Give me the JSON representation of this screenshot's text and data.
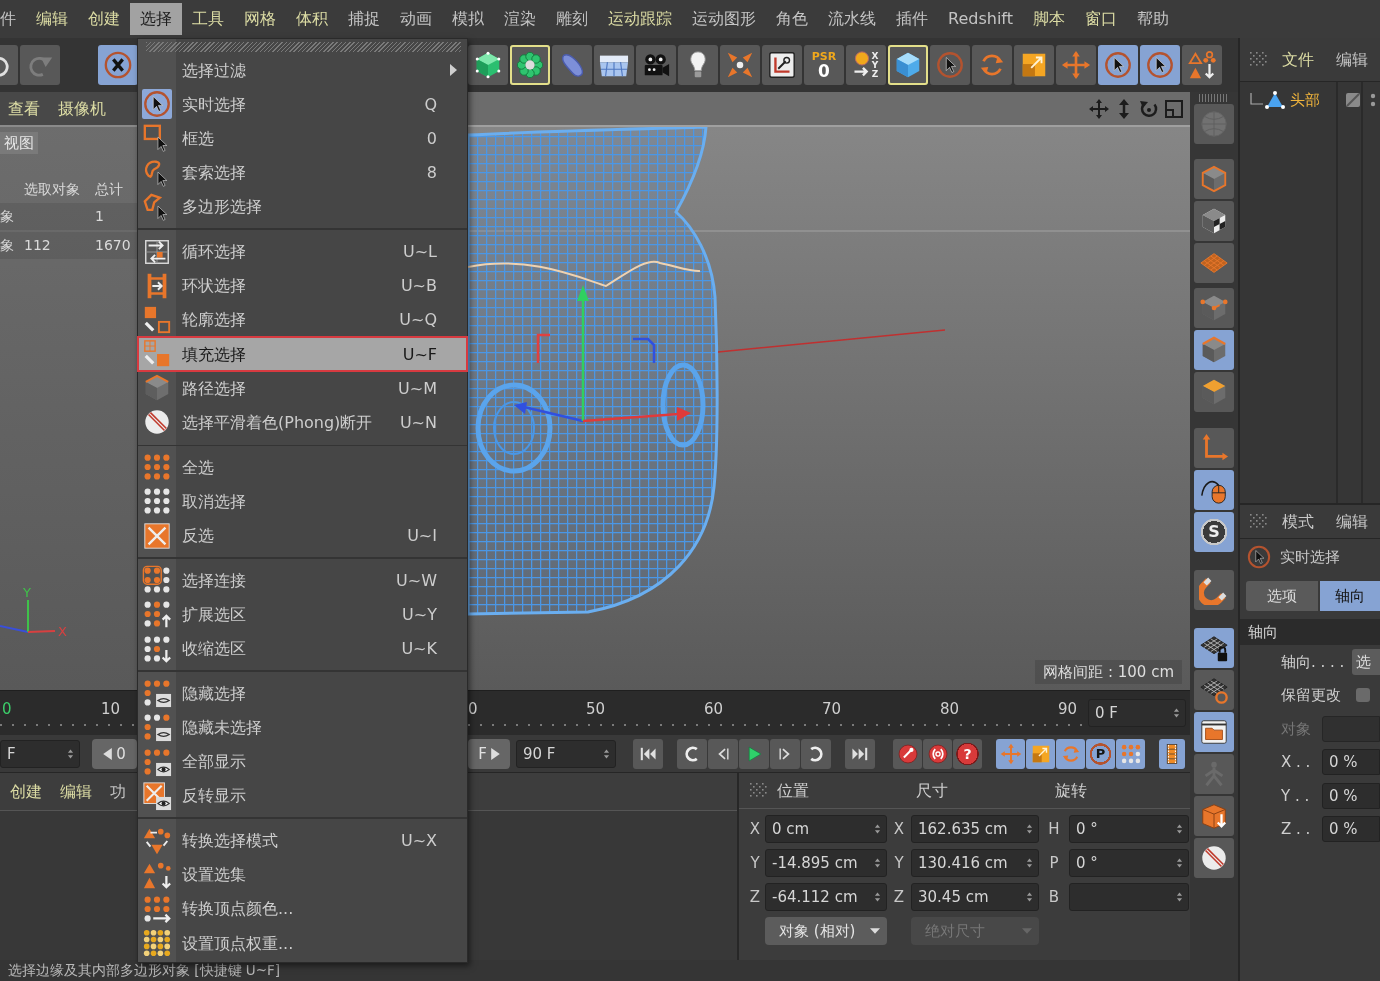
{
  "menu_bar": [
    {
      "label": "件",
      "color": "#c4c4c4",
      "selected": false
    },
    {
      "label": "编辑",
      "color": "#dcdca4",
      "selected": false
    },
    {
      "label": "创建",
      "color": "#dcdca4",
      "selected": false
    },
    {
      "label": "选择",
      "selected": true
    },
    {
      "label": "工具",
      "color": "#dcdca4",
      "selected": false
    },
    {
      "label": "网格",
      "color": "#dcdca4",
      "selected": false
    },
    {
      "label": "体积",
      "color": "#dcdca4",
      "selected": false
    },
    {
      "label": "捕捉",
      "color": "#c4c4c4",
      "selected": false
    },
    {
      "label": "动画",
      "color": "#c4c4c4",
      "selected": false
    },
    {
      "label": "模拟",
      "color": "#c4c4c4",
      "selected": false
    },
    {
      "label": "渲染",
      "color": "#c4c4c4",
      "selected": false
    },
    {
      "label": "雕刻",
      "color": "#c4c4c4",
      "selected": false
    },
    {
      "label": "运动跟踪",
      "color": "#dcdca4",
      "selected": false
    },
    {
      "label": "运动图形",
      "color": "#c4c4c4",
      "selected": false
    },
    {
      "label": "角色",
      "color": "#c4c4c4",
      "selected": false
    },
    {
      "label": "流水线",
      "color": "#c4c4c4",
      "selected": false
    },
    {
      "label": "插件",
      "color": "#c4c4c4",
      "selected": false
    },
    {
      "label": "Redshift",
      "color": "#c4c4c4",
      "selected": false
    },
    {
      "label": "脚本",
      "color": "#dcdca4",
      "selected": false
    },
    {
      "label": "窗口",
      "color": "#dcdca4",
      "selected": false
    },
    {
      "label": "帮助",
      "color": "#c4c4c4",
      "selected": false
    }
  ],
  "main_toolbar": [
    {
      "on": false,
      "framed": false,
      "disabled": false
    },
    {
      "on": false,
      "framed": false,
      "disabled": true
    },
    {
      "on": true,
      "framed": false,
      "disabled": false
    },
    {
      "on": false,
      "framed": false,
      "disabled": false
    },
    {
      "on": false,
      "framed": true,
      "disabled": false
    },
    {
      "on": false,
      "framed": false,
      "disabled": false
    },
    {
      "on": false,
      "framed": false,
      "disabled": false
    },
    {
      "on": false,
      "framed": false,
      "disabled": false
    },
    {
      "on": false,
      "framed": false,
      "disabled": false
    },
    {
      "on": false,
      "framed": false,
      "disabled": false
    },
    {
      "on": false,
      "framed": false,
      "disabled": false
    },
    {
      "on": false,
      "framed": false,
      "disabled": false,
      "text": "PSR",
      "value": "0"
    },
    {
      "on": false,
      "framed": false,
      "disabled": false,
      "text": "XYZ"
    },
    {
      "on": false,
      "framed": true,
      "disabled": false
    },
    {
      "on": false,
      "framed": false,
      "disabled": false
    },
    {
      "on": false,
      "framed": false,
      "disabled": false
    },
    {
      "on": false,
      "framed": false,
      "disabled": false
    },
    {
      "on": false,
      "framed": false,
      "disabled": false
    },
    {
      "on": true,
      "framed": false,
      "disabled": false
    },
    {
      "on": true,
      "framed": false,
      "disabled": false
    },
    {
      "on": false,
      "framed": false,
      "disabled": false
    }
  ],
  "select_menu": {
    "sections": [
      {
        "items": [
          {
            "label": "选择过滤",
            "submenu": true,
            "active": false,
            "selected": false,
            "annotated": false
          },
          {
            "label": "实时选择",
            "shortcut": "Q",
            "submenu": false,
            "active": true,
            "selected": false,
            "annotated": false
          },
          {
            "label": "框选",
            "shortcut": "0",
            "submenu": false,
            "active": false,
            "selected": false,
            "annotated": false
          },
          {
            "label": "套索选择",
            "shortcut": "8",
            "submenu": false,
            "active": false,
            "selected": false,
            "annotated": false
          },
          {
            "label": "多边形选择",
            "submenu": false,
            "active": false,
            "selected": false,
            "annotated": false
          }
        ]
      },
      {
        "items": [
          {
            "label": "循环选择",
            "shortcut": "U~L",
            "submenu": false,
            "active": false,
            "selected": false,
            "annotated": false
          },
          {
            "label": "环状选择",
            "shortcut": "U~B",
            "submenu": false,
            "active": false,
            "selected": false,
            "annotated": false
          },
          {
            "label": "轮廓选择",
            "shortcut": "U~Q",
            "submenu": false,
            "active": false,
            "selected": false,
            "annotated": false
          },
          {
            "label": "填充选择",
            "shortcut": "U~F",
            "submenu": false,
            "active": false,
            "selected": true,
            "annotated": true
          },
          {
            "label": "路径选择",
            "shortcut": "U~M",
            "submenu": false,
            "active": false,
            "selected": false,
            "annotated": false
          },
          {
            "label": "选择平滑着色(Phong)断开",
            "shortcut": "U~N",
            "submenu": false,
            "active": false,
            "selected": false,
            "annotated": false
          }
        ]
      },
      {
        "items": [
          {
            "label": "全选",
            "submenu": false,
            "active": false,
            "selected": false,
            "annotated": false
          },
          {
            "label": "取消选择",
            "submenu": false,
            "active": false,
            "selected": false,
            "annotated": false
          },
          {
            "label": "反选",
            "shortcut": "U~I",
            "submenu": false,
            "active": false,
            "selected": false,
            "annotated": false
          }
        ]
      },
      {
        "items": [
          {
            "label": "选择连接",
            "shortcut": "U~W",
            "submenu": false,
            "active": false,
            "selected": false,
            "annotated": false
          },
          {
            "label": "扩展选区",
            "shortcut": "U~Y",
            "submenu": false,
            "active": false,
            "selected": false,
            "annotated": false
          },
          {
            "label": "收缩选区",
            "shortcut": "U~K",
            "submenu": false,
            "active": false,
            "selected": false,
            "annotated": false
          }
        ]
      },
      {
        "items": [
          {
            "label": "隐藏选择",
            "submenu": false,
            "active": false,
            "selected": false,
            "annotated": false
          },
          {
            "label": "隐藏未选择",
            "submenu": false,
            "active": false,
            "selected": false,
            "annotated": false
          },
          {
            "label": "全部显示",
            "submenu": false,
            "active": false,
            "selected": false,
            "annotated": false
          },
          {
            "label": "反转显示",
            "submenu": false,
            "active": false,
            "selected": false,
            "annotated": false
          }
        ]
      },
      {
        "items": [
          {
            "label": "转换选择模式",
            "shortcut": "U~X",
            "submenu": false,
            "active": false,
            "selected": false,
            "annotated": false
          },
          {
            "label": "设置选集",
            "submenu": false,
            "active": false,
            "selected": false,
            "annotated": false
          },
          {
            "label": "转换顶点颜色...",
            "submenu": false,
            "active": false,
            "selected": false,
            "annotated": false
          },
          {
            "label": "设置顶点权重...",
            "submenu": false,
            "active": false,
            "selected": false,
            "annotated": false
          }
        ]
      }
    ]
  },
  "viewport": {
    "menu": [
      "查看",
      "摄像机"
    ],
    "view_name": "视图",
    "hud": {
      "columns": [
        "选取对象",
        "总计"
      ],
      "rows": [
        {
          "name": "象",
          "total": "1"
        },
        {
          "name": "象",
          "selected": "112",
          "total": "1670"
        }
      ]
    },
    "axes": [
      "Y",
      "X"
    ],
    "grid_spacing": "网格间距 : 100 cm"
  },
  "timeline": {
    "left_ticks": [
      {
        "label": "0",
        "current": true
      },
      {
        "label": "10",
        "current": false
      }
    ],
    "right_ticks": [
      {
        "label": "0",
        "current": false
      },
      {
        "label": "50",
        "current": false
      },
      {
        "label": "60",
        "current": false
      },
      {
        "label": "70",
        "current": false
      },
      {
        "label": "80",
        "current": false
      },
      {
        "label": "90",
        "current": false
      }
    ],
    "frame_field": "0 F"
  },
  "playback": {
    "start_field": "F",
    "back_button": "0",
    "forward_button": "F",
    "end_field": "90 F",
    "controls": [
      {
        "on": false
      },
      {
        "on": false
      },
      {
        "on": false
      },
      {
        "on": false
      },
      {
        "on": false
      },
      {
        "on": false
      },
      {
        "on": false
      },
      {
        "on": false
      },
      {
        "on": false
      },
      {
        "on": false,
        "text": "?"
      },
      {
        "on": true
      },
      {
        "on": true
      },
      {
        "on": true
      },
      {
        "on": true,
        "text": "P"
      },
      {
        "on": true
      },
      {
        "on": true
      }
    ]
  },
  "material_manager": {
    "menu": [
      {
        "label": "创建",
        "color": "#dcdca4"
      },
      {
        "label": "编辑",
        "color": "#dcdca4"
      },
      {
        "label": "功",
        "color": "#c4c4c4"
      }
    ]
  },
  "coordinates": {
    "headers": [
      "位置",
      "尺寸",
      "旋转"
    ],
    "rows": [
      {
        "position_axis": "X",
        "position": "0 cm",
        "size_axis": "X",
        "size": "162.635 cm",
        "rotation_axis": "H",
        "rotation": "0 °"
      },
      {
        "position_axis": "Y",
        "position": "-14.895 cm",
        "size_axis": "Y",
        "size": "130.416 cm",
        "rotation_axis": "P",
        "rotation": "0 °"
      },
      {
        "position_axis": "Z",
        "position": "-64.112 cm",
        "size_axis": "Z",
        "size": "30.45 cm",
        "rotation_axis": "B"
      }
    ],
    "dropdowns": [
      {
        "label": "对象 (相对)",
        "disabled": false
      },
      {
        "label": "绝对尺寸",
        "disabled": true
      }
    ]
  },
  "status_bar": "选择边缘及其内部多边形对象 [快捷键 U~F]",
  "side_toolbar": [
    {
      "on": false,
      "disabled": true
    },
    {
      "on": false,
      "disabled": false
    },
    {
      "on": false,
      "disabled": false
    },
    {
      "on": false,
      "disabled": false
    },
    {
      "on": false,
      "disabled": false
    },
    {
      "on": true,
      "disabled": false
    },
    {
      "on": false,
      "disabled": false
    },
    {
      "on": false,
      "disabled": false
    },
    {
      "on": true,
      "disabled": false
    },
    {
      "on": true,
      "disabled": false,
      "text": "S"
    },
    {
      "on": false,
      "disabled": false
    },
    {
      "on": true,
      "disabled": false
    },
    {
      "on": false,
      "disabled": false
    },
    {
      "on": true,
      "disabled": false
    },
    {
      "on": false,
      "disabled": true
    },
    {
      "on": false,
      "disabled": false
    },
    {
      "on": false,
      "disabled": false
    }
  ],
  "object_manager": {
    "menu": [
      {
        "label": "文件",
        "color": "#dcdca4"
      },
      {
        "label": "编辑",
        "color": "#c4c4c4"
      }
    ],
    "objects": [
      {
        "label": "头部",
        "selected": true
      }
    ]
  },
  "attribute_manager": {
    "menu": [
      "模式",
      "编辑"
    ],
    "tool": "实时选择",
    "tabs": [
      {
        "label": "选项",
        "selected": false
      },
      {
        "label": "轴向",
        "selected": true
      }
    ],
    "section": "轴向",
    "rows": [
      {
        "kind": "button",
        "label": "轴向. . . .",
        "value": "选",
        "disabled": false
      },
      {
        "kind": "checkbox",
        "label": "保留更改",
        "checked": false,
        "disabled": false
      },
      {
        "kind": "field",
        "label": "对象",
        "disabled": true
      },
      {
        "kind": "field",
        "label": "X . .",
        "value": "0 %",
        "disabled": false
      },
      {
        "kind": "field",
        "label": "Y . .",
        "value": "0 %",
        "disabled": false
      },
      {
        "kind": "field",
        "label": "Z . .",
        "value": "0 %",
        "disabled": false
      }
    ]
  }
}
